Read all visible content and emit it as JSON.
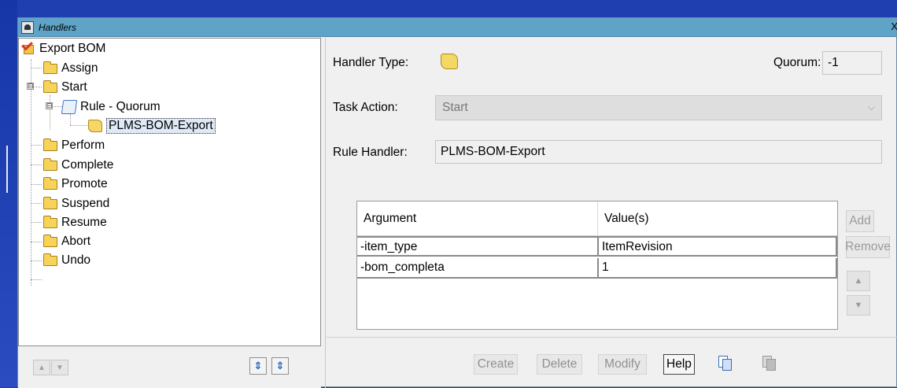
{
  "window": {
    "title": "Handlers",
    "close": "X"
  },
  "tree": {
    "root": "Export BOM",
    "items": [
      {
        "label": "Assign"
      },
      {
        "label": "Start"
      },
      {
        "label": "Rule - Quorum"
      },
      {
        "label": "PLMS-BOM-Export"
      },
      {
        "label": "Perform"
      },
      {
        "label": "Complete"
      },
      {
        "label": "Promote"
      },
      {
        "label": "Suspend"
      },
      {
        "label": "Resume"
      },
      {
        "label": "Abort"
      },
      {
        "label": "Undo"
      }
    ],
    "collapse_glyph": "⊟"
  },
  "form": {
    "handler_type_label": "Handler Type:",
    "quorum_label": "Quorum:",
    "quorum_value": "-1",
    "task_action_label": "Task Action:",
    "task_action_value": "Start",
    "rule_handler_label": "Rule Handler:",
    "rule_handler_value": "PLMS-BOM-Export"
  },
  "grid": {
    "columns": [
      "Argument",
      "Value(s)"
    ],
    "rows": [
      {
        "argument": "-item_type",
        "value": "ItemRevision"
      },
      {
        "argument": "-bom_completa",
        "value": "1"
      }
    ],
    "add_label": "Add",
    "remove_label": "Remove"
  },
  "buttons": {
    "create": "Create",
    "delete": "Delete",
    "modify": "Modify",
    "help": "Help"
  }
}
